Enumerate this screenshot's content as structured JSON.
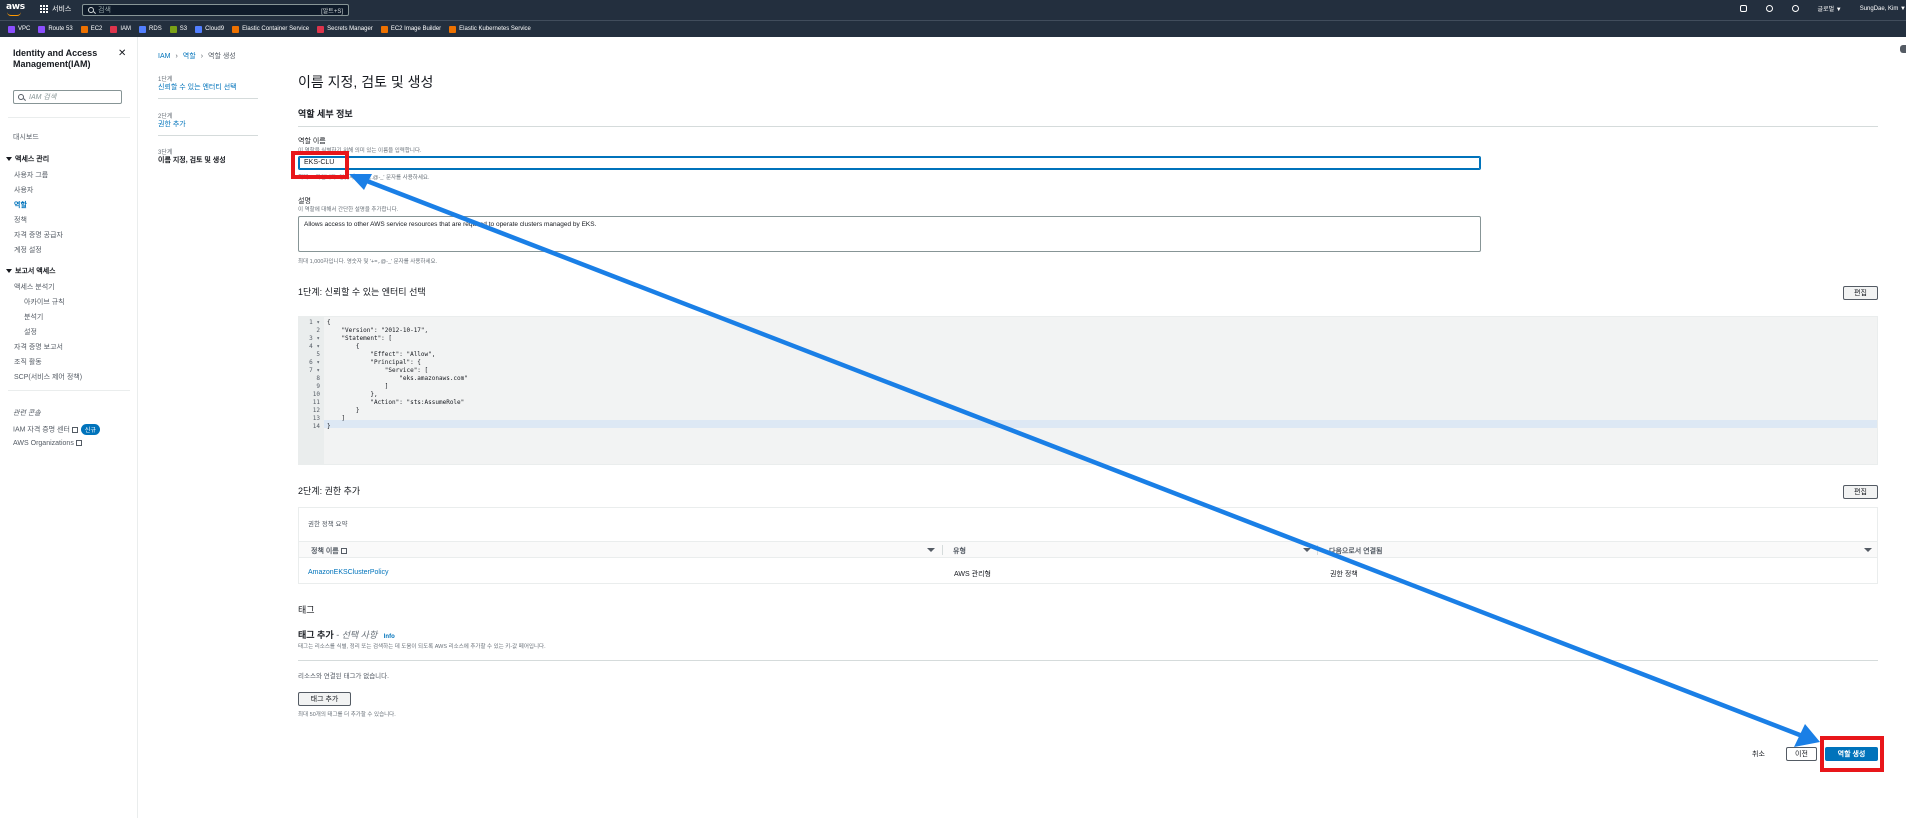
{
  "topnav": {
    "services_label": "서비스",
    "search_placeholder": "검색",
    "search_shortcut": "[알트+S]",
    "region_label": "글로벌 ▼",
    "account_label": "SungDae, Kim ▼"
  },
  "favorites": [
    {
      "label": "VPC",
      "color": "#8c4fff"
    },
    {
      "label": "Route 53",
      "color": "#8c4fff"
    },
    {
      "label": "EC2",
      "color": "#ed7100"
    },
    {
      "label": "IAM",
      "color": "#dd344c"
    },
    {
      "label": "RDS",
      "color": "#527fff"
    },
    {
      "label": "S3",
      "color": "#7aa116"
    },
    {
      "label": "Cloud9",
      "color": "#527fff"
    },
    {
      "label": "Elastic Container Service",
      "color": "#ed7100"
    },
    {
      "label": "Secrets Manager",
      "color": "#dd344c"
    },
    {
      "label": "EC2 Image Builder",
      "color": "#ed7100"
    },
    {
      "label": "Elastic Kubernetes Service",
      "color": "#ed7100"
    }
  ],
  "sidenav": {
    "title": "Identity and Access Management(IAM)",
    "search_placeholder": "IAM 검색",
    "dashboard": "대시보드",
    "access_mgmt": "액세스 관리",
    "user_groups": "사용자 그룹",
    "users": "사용자",
    "roles": "역할",
    "policies": "정책",
    "identity_providers": "자격 증명 공급자",
    "account_settings": "계정 설정",
    "access_reports": "보고서 액세스",
    "access_analyzer": "액세스 분석기",
    "archive_rules": "아카이브 규칙",
    "analyzers": "분석기",
    "settings": "설정",
    "credential_report": "자격 증명 보고서",
    "org_activity": "조직 활동",
    "scp": "SCP(서비스 제어 정책)",
    "related": "관련 콘솔",
    "iam_identity_center": "IAM 자격 증명 센터",
    "new_badge": "신규",
    "aws_organizations": "AWS Organizations"
  },
  "breadcrumb": {
    "iam": "IAM",
    "roles": "역할",
    "current": "역할 생성"
  },
  "steps": [
    {
      "small": "1단계",
      "label": "신뢰할 수 있는 엔터티 선택"
    },
    {
      "small": "2단계",
      "label": "권한 추가"
    },
    {
      "small": "3단계",
      "label": "이름 지정, 검토 및 생성"
    }
  ],
  "page": {
    "title": "이름 지정, 검토 및 생성",
    "role_details": "역할 세부 정보",
    "role_name_label": "역할 이름",
    "role_name_desc": "이 역할을 식별하기 위해 의미 있는 이름을 입력합니다.",
    "role_name_value": "EKS-CLU",
    "role_name_hint": "최대 64자입니다. 영숫자 및 '+=,.@-_' 문자를 사용하세요.",
    "desc_label": "설명",
    "desc_desc": "이 역할에 대해서 간단한 설명을 추가합니다.",
    "desc_value": "Allows access to other AWS service resources that are required to operate clusters managed by EKS.",
    "desc_hint": "최대 1,000자입니다. 영숫자 및 '+=,.@-_' 문자를 사용하세요.",
    "step1_title": "1단계: 신뢰할 수 있는 엔터티 선택",
    "edit_label": "편집",
    "step2_title": "2단계: 권한 추가",
    "perm_summary": "권한 정책 요약",
    "col_policy": "정책 이름",
    "col_type": "유형",
    "col_attached": "다음으로서 연결됨",
    "row_policy": "AmazonEKSClusterPolicy",
    "row_type": "AWS 관리형",
    "row_attached": "권한 정책",
    "tags_title": "태그",
    "add_tags_title": "태그 추가",
    "add_tags_optional": " - 선택 사항",
    "info": "Info",
    "tags_desc": "태그는 리소스를 식별, 정리 또는 검색하는 데 도움이 되도록 AWS 리소스에 추가할 수 있는 키-값 페어입니다.",
    "no_tags": "리소스와 연결된 태그가 없습니다.",
    "add_tag_btn": "태그 추가",
    "tags_limit": "최대 50개의 태그를 더 추가할 수 있습니다.",
    "cancel": "취소",
    "previous": "이전",
    "create_role": "역할 생성"
  },
  "trust_policy_lines": [
    "{",
    "    \"Version\": \"2012-10-17\",",
    "    \"Statement\": [",
    "        {",
    "            \"Effect\": \"Allow\",",
    "            \"Principal\": {",
    "                \"Service\": [",
    "                    \"eks.amazonaws.com\"",
    "                ]",
    "            },",
    "            \"Action\": \"sts:AssumeRole\"",
    "        }",
    "    ]",
    "}"
  ],
  "annotation": {
    "highlight_color": "#e8161a",
    "arrow_color": "#1a7fe6"
  }
}
